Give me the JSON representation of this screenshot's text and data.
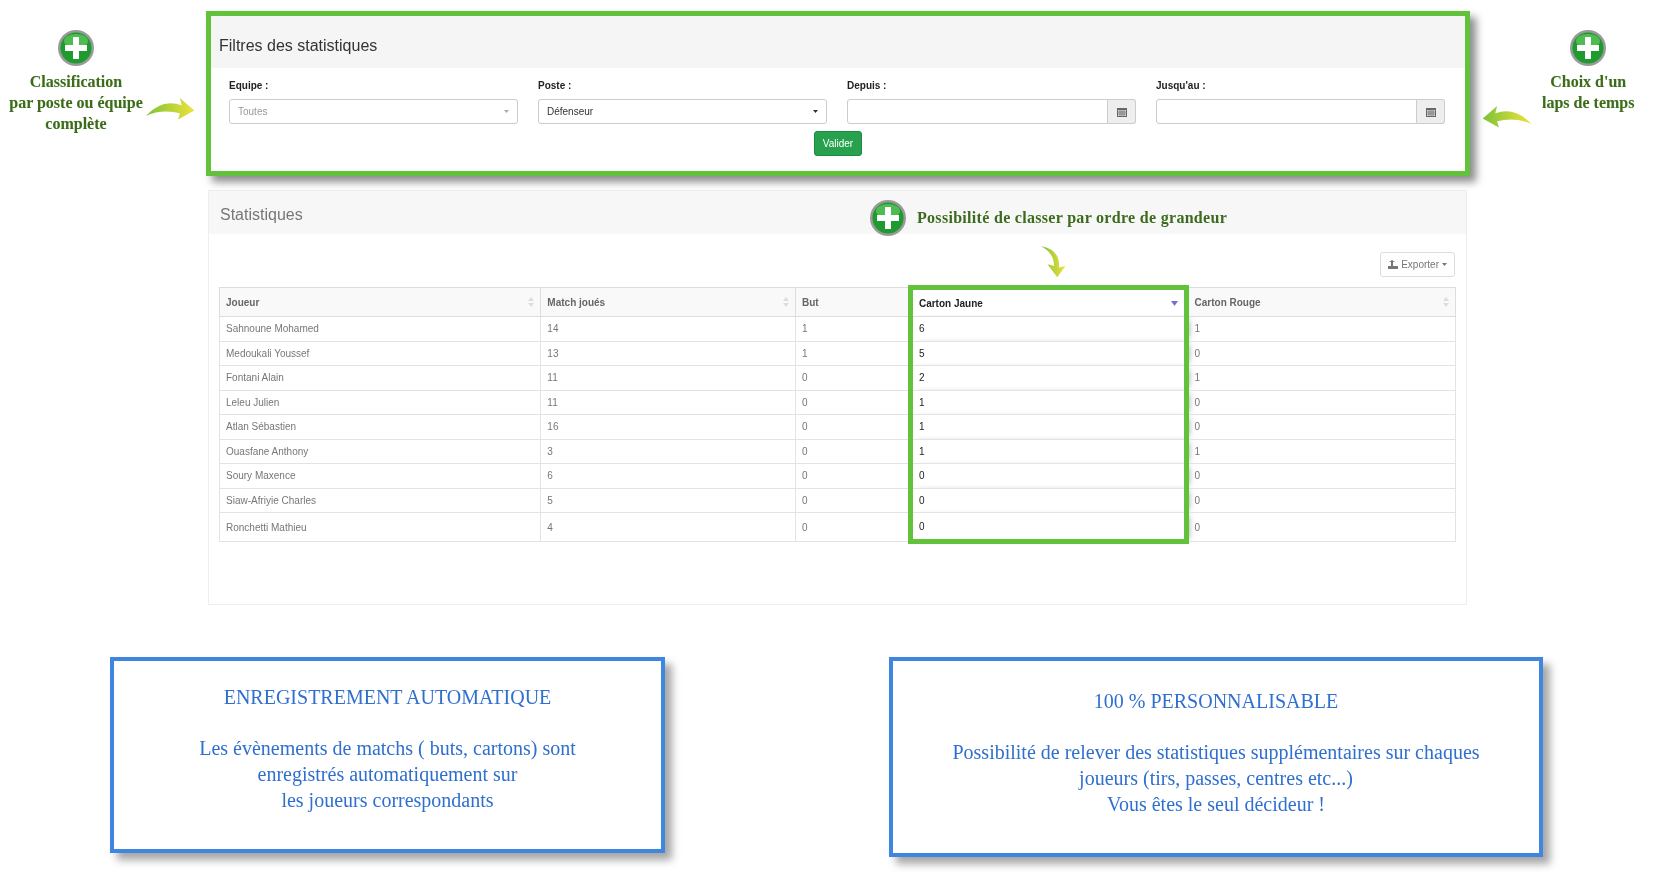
{
  "filter_note_left": {
    "lines": [
      "Classification",
      "par poste ou équipe",
      "complète"
    ]
  },
  "filter_panel": {
    "title": "Filtres des statistiques",
    "fields": [
      {
        "kind": "select",
        "label": "Equipe :",
        "placeholder": "Toutes"
      },
      {
        "kind": "select",
        "label": "Poste :",
        "value": "Défenseur"
      },
      {
        "kind": "date",
        "label": "Depuis :"
      },
      {
        "kind": "date",
        "label": "Jusqu'au :"
      }
    ],
    "submit": "Valider"
  },
  "filter_note_right": {
    "lines": [
      "Choix d'un",
      "laps de temps"
    ]
  },
  "stats_panel": {
    "title": "Statistiques",
    "sort_note": "Possibilité de classer par ordre de grandeur",
    "export_button": "Exporter",
    "table": {
      "columns": [
        {
          "label": "Joueur",
          "sortable": true,
          "sorted": false,
          "highlighted": false
        },
        {
          "label": "Match joués",
          "sortable": true,
          "sorted": false,
          "highlighted": false
        },
        {
          "label": "But",
          "sortable": false,
          "sorted": false,
          "highlighted": false
        },
        {
          "label": "Carton Jaune",
          "sorted": true,
          "highlighted": true
        },
        {
          "label": "Carton Rouge",
          "sortable": true,
          "sorted": false,
          "highlighted": false
        }
      ],
      "rows": [
        [
          "Sahnoune Mohamed",
          "14",
          "1",
          "6",
          "1"
        ],
        [
          "Medoukali Youssef",
          "13",
          "1",
          "5",
          "0"
        ],
        [
          "Fontani Alain",
          "11",
          "0",
          "2",
          "1"
        ],
        [
          "Leleu Julien",
          "11",
          "0",
          "1",
          "0"
        ],
        [
          "Atlan Sébastien",
          "16",
          "0",
          "1",
          "0"
        ],
        [
          "Ouasfane Anthony",
          "3",
          "0",
          "1",
          "1"
        ],
        [
          "Soury Maxence",
          "6",
          "0",
          "0",
          "0"
        ],
        [
          "Siaw-Afriyie Charles",
          "5",
          "0",
          "0",
          "0"
        ],
        [
          "Ronchetti Mathieu",
          "4",
          "0",
          "0",
          "0"
        ]
      ]
    }
  },
  "feature_boxes": [
    {
      "title": "ENREGISTREMENT AUTOMATIQUE",
      "lines": [
        "Les évènements de matchs ( buts, cartons) sont",
        "enregistrés automatiquement sur",
        "les joueurs correspondants"
      ]
    },
    {
      "title": "100 % PERSONNALISABLE",
      "lines": [
        "Possibilité de relever des statistiques supplémentaires sur chaques",
        "joueurs (tirs, passes, centres etc...)",
        "Vous êtes le seul décideur !"
      ]
    }
  ]
}
